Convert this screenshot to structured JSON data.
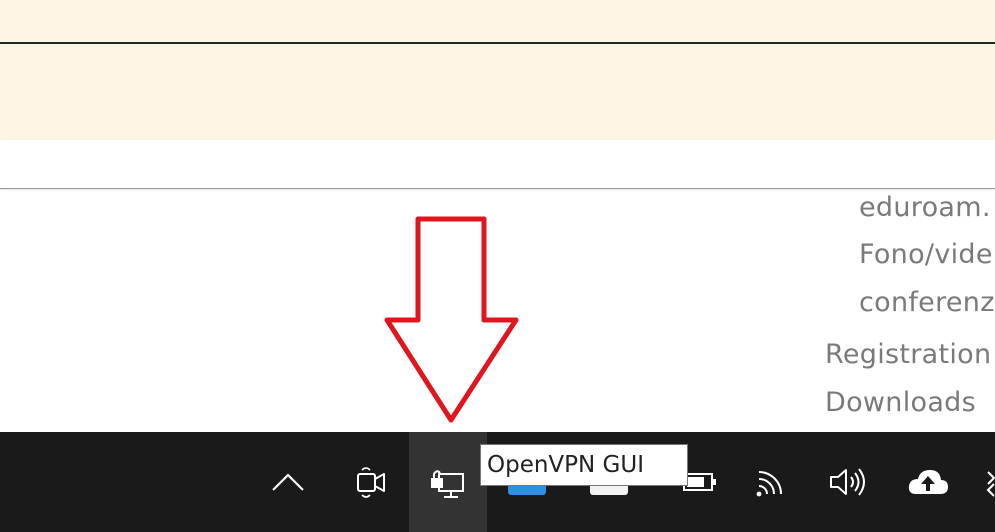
{
  "page": {
    "menu_items": [
      "eduroam.",
      "Fono/vide",
      "conferenz",
      "Registration",
      "Downloads"
    ]
  },
  "annotation": {
    "arrow_color": "#e0151d"
  },
  "taskbar": {
    "icons": [
      "chevron-up-icon",
      "camera-in-use-icon",
      "openvpn-gui-icon",
      "tray-app-blue-icon",
      "tray-app-white-icon",
      "battery-icon",
      "wifi-icon",
      "volume-icon",
      "cloud-upload-icon"
    ],
    "tooltip": "OpenVPN GUI"
  },
  "colors": {
    "banner_bg": "#fcf5e3",
    "taskbar_bg": "#1a1a1a",
    "menu_text": "#7a7a7a",
    "tray_blue": "#2f8fe0"
  }
}
